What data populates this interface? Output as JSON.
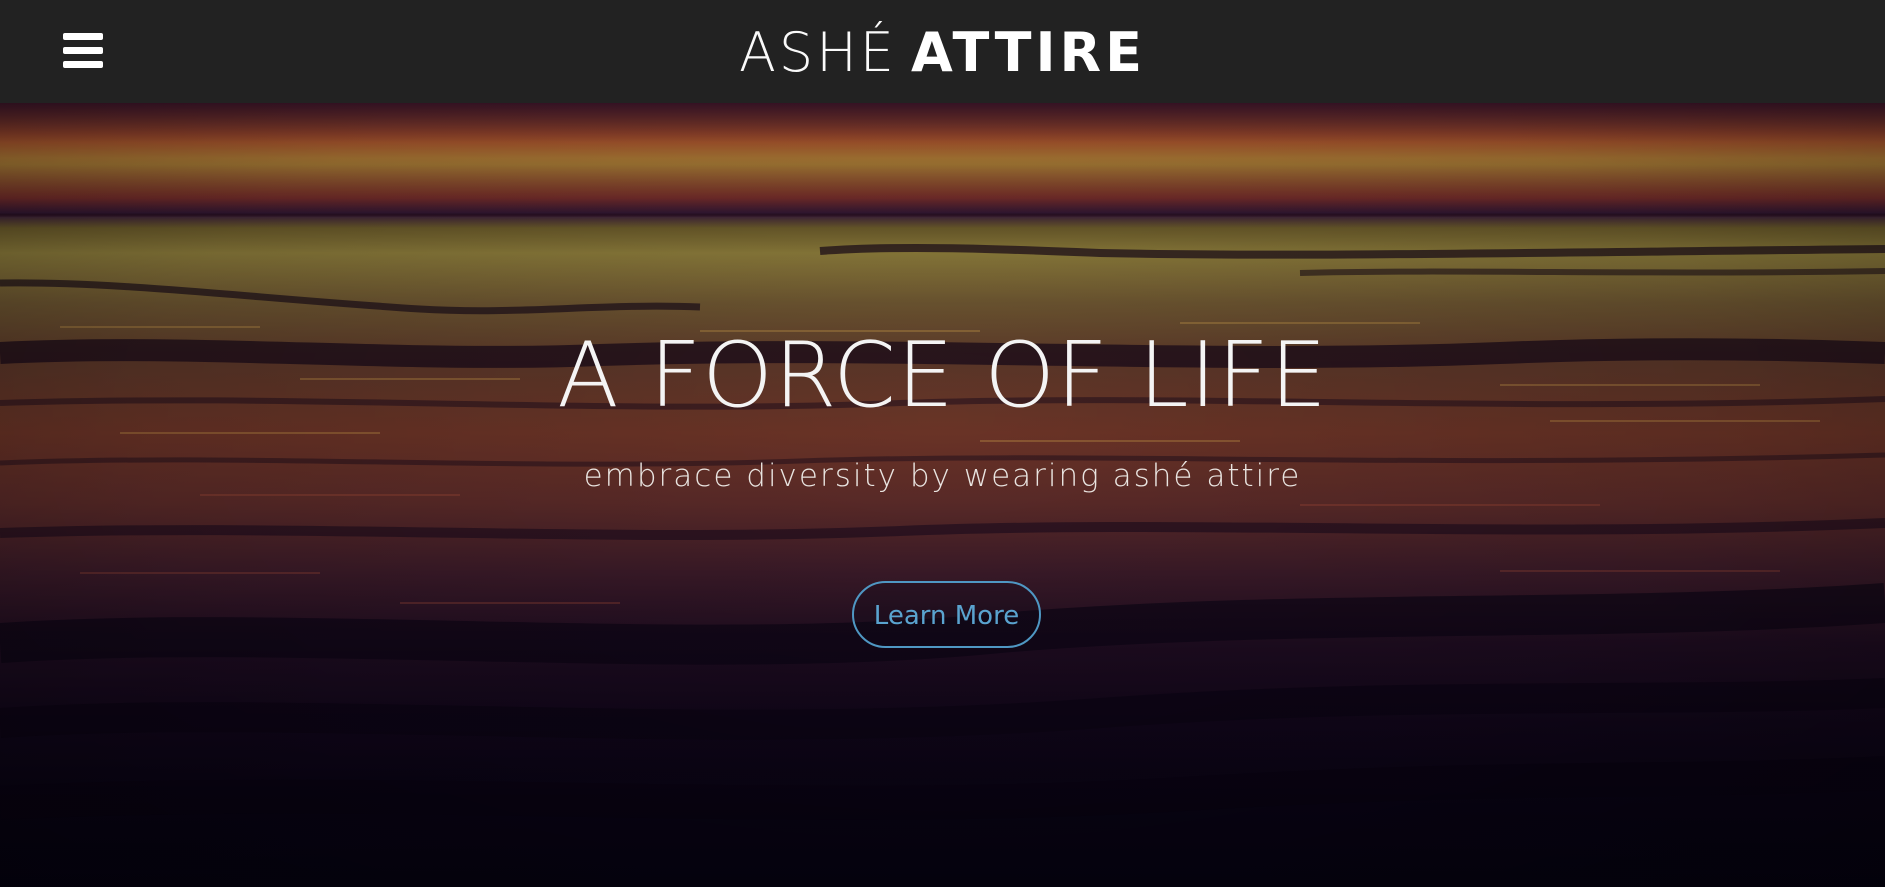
{
  "header": {
    "brand_light": "ASHÉ",
    "brand_bold": "ATTIRE",
    "menu_icon": "hamburger-menu-icon"
  },
  "hero": {
    "title": "A FORCE OF LIFE",
    "subtitle": "embrace diversity by wearing ashé attire",
    "cta_label": "Learn More",
    "background": "sunset-ocean-waves-photo"
  },
  "colors": {
    "header_bg": "#222222",
    "text": "#ffffff",
    "cta_accent": "#4f97c3"
  }
}
